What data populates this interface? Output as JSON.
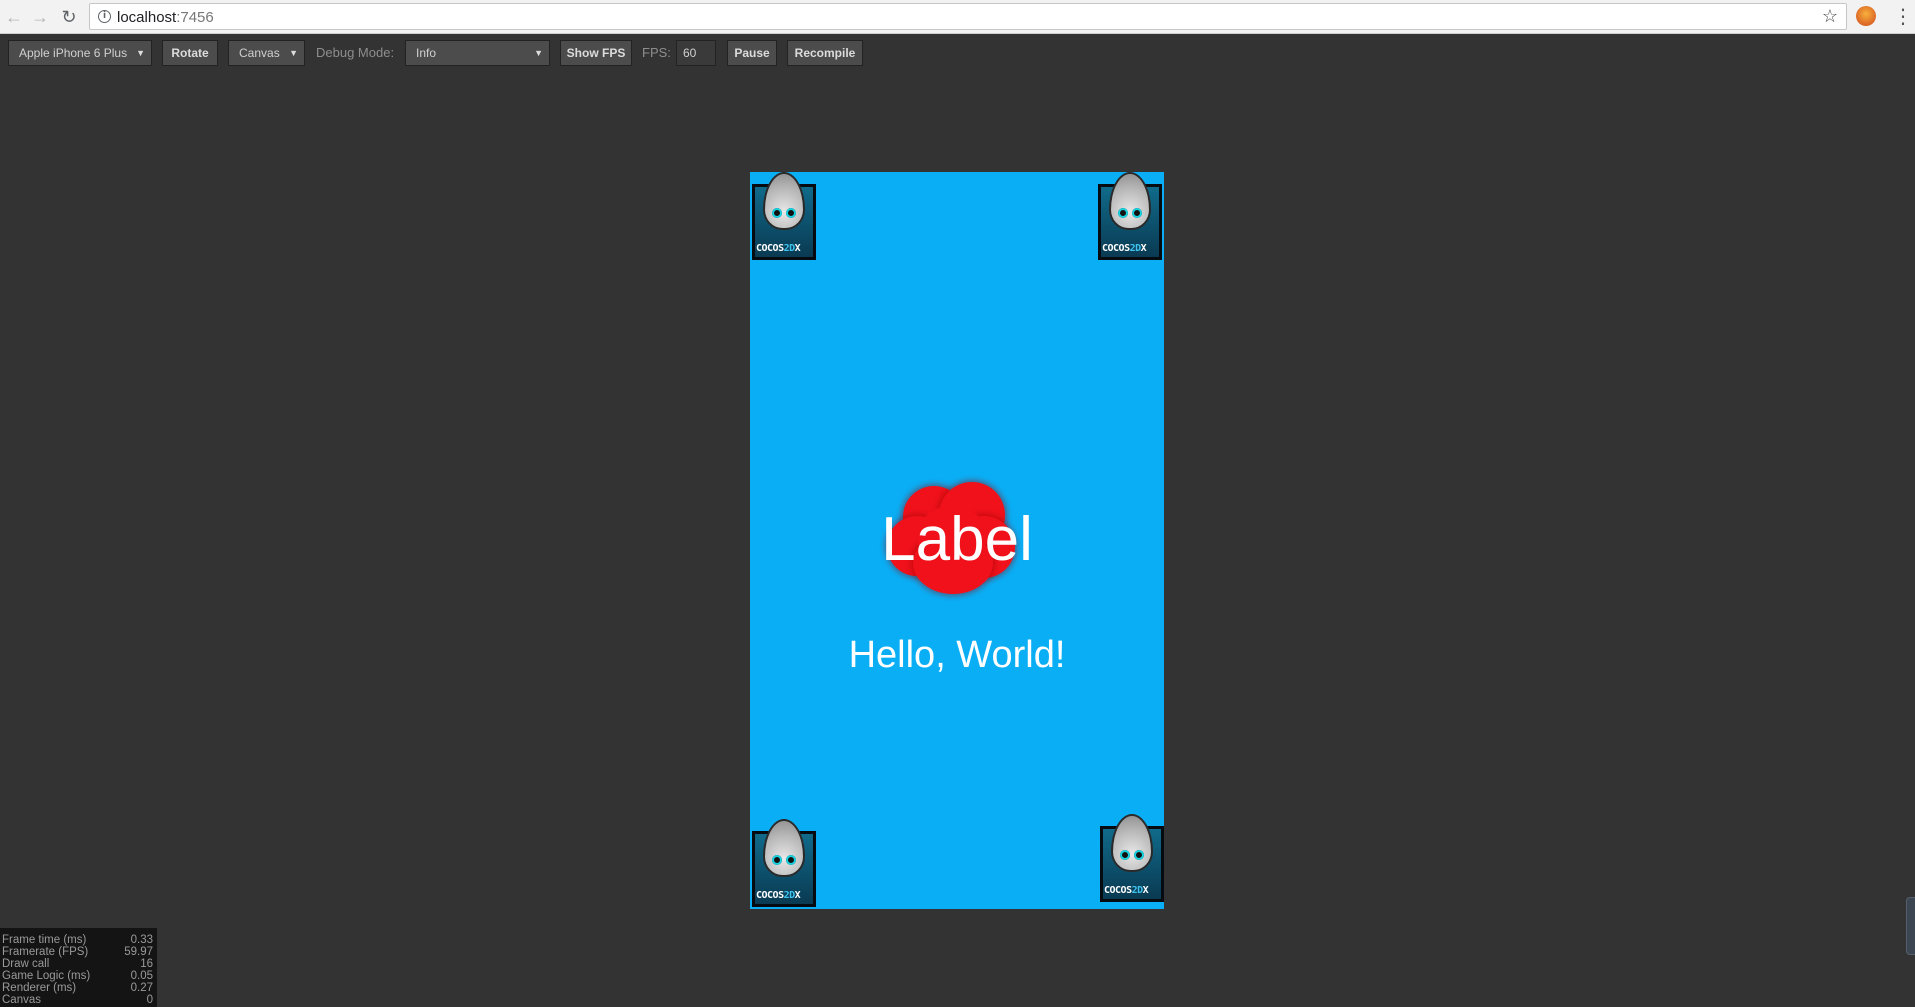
{
  "browser": {
    "url_host": "localhost",
    "url_port": ":7456",
    "icons": {
      "back": "arrow-left-icon",
      "forward": "arrow-right-icon",
      "reload": "reload-icon",
      "info": "info-icon",
      "bookmark": "star-icon",
      "extension": "extension-icon",
      "menu": "more-vertical-icon"
    }
  },
  "toolbar": {
    "device_select": "Apple iPhone 6 Plus",
    "rotate_label": "Rotate",
    "renderer_select": "Canvas",
    "debug_mode_label": "Debug Mode:",
    "debug_mode_select": "Info",
    "show_fps_label": "Show FPS",
    "fps_label": "FPS:",
    "fps_value": "60",
    "pause_label": "Pause",
    "recompile_label": "Recompile"
  },
  "game": {
    "background": "#0aaef5",
    "logo_text_left": "COCOS",
    "logo_text_highlight": "2D",
    "logo_text_right": "X",
    "cloud_label": "Label",
    "cloud_color": "#f0111b",
    "hello_text": "Hello, World!"
  },
  "stats": [
    {
      "label": "Frame time (ms)",
      "value": "0.33"
    },
    {
      "label": "Framerate (FPS)",
      "value": "59.97"
    },
    {
      "label": "Draw call",
      "value": "16"
    },
    {
      "label": "Game Logic (ms)",
      "value": "0.05"
    },
    {
      "label": "Renderer (ms)",
      "value": "0.27"
    },
    {
      "label": "Canvas",
      "value": "0"
    }
  ]
}
